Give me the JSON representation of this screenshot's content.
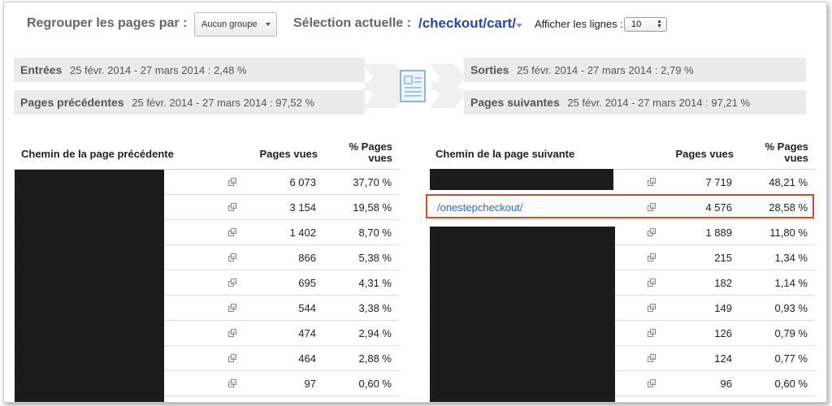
{
  "toolbar": {
    "group_label": "Regrouper les pages par :",
    "group_select_value": "Aucun groupe",
    "selection_label": "Sélection actuelle :",
    "selection_value": "/checkout/cart/",
    "rows_label": "Afficher les lignes :",
    "rows_value": "10"
  },
  "summary": {
    "entrees": {
      "title": "Entrées",
      "detail": "25 févr. 2014 - 27 mars 2014 : 2,48 %"
    },
    "precedentes": {
      "title": "Pages précédentes",
      "detail": "25 févr. 2014 - 27 mars 2014 : 97,52 %"
    },
    "sorties": {
      "title": "Sorties",
      "detail": "25 févr. 2014 - 27 mars 2014 : 2,79 %"
    },
    "suivantes": {
      "title": "Pages suivantes",
      "detail": "25 févr. 2014 - 27 mars 2014 : 97,21 %"
    }
  },
  "left_table": {
    "headers": {
      "path": "Chemin de la page précédente",
      "views": "Pages vues",
      "pct": "% Pages vues"
    },
    "rows": [
      {
        "views": "6 073",
        "pct": "37,70 %"
      },
      {
        "views": "3 154",
        "pct": "19,58 %"
      },
      {
        "views": "1 402",
        "pct": "8,70 %"
      },
      {
        "views": "866",
        "pct": "5,38 %"
      },
      {
        "views": "695",
        "pct": "4,31 %"
      },
      {
        "views": "544",
        "pct": "3,38 %"
      },
      {
        "views": "474",
        "pct": "2,94 %"
      },
      {
        "views": "464",
        "pct": "2,88 %"
      },
      {
        "views": "97",
        "pct": "0,60 %"
      }
    ]
  },
  "right_table": {
    "headers": {
      "path": "Chemin de la page suivante",
      "views": "Pages vues",
      "pct": "% Pages vues"
    },
    "rows": [
      {
        "path": "",
        "views": "7 719",
        "pct": "48,21 %"
      },
      {
        "path": "/onestepcheckout/",
        "views": "4 576",
        "pct": "28,58 %"
      },
      {
        "path": "",
        "views": "1 889",
        "pct": "11,80 %"
      },
      {
        "path": "",
        "views": "215",
        "pct": "1,34 %"
      },
      {
        "path": "",
        "views": "182",
        "pct": "1,14 %"
      },
      {
        "path": "",
        "views": "149",
        "pct": "0,93 %"
      },
      {
        "path": "",
        "views": "126",
        "pct": "0,79 %"
      },
      {
        "path": "",
        "views": "124",
        "pct": "0,77 %"
      },
      {
        "path": "",
        "views": "96",
        "pct": "0,60 %"
      }
    ]
  },
  "icons": {
    "row_action": "external-link-icon",
    "center": "document-icon"
  },
  "colors": {
    "link": "#2a6ab6",
    "selection": "#2947a8",
    "highlight_border": "#d64a2c",
    "summary_bg": "#ebebeb"
  }
}
